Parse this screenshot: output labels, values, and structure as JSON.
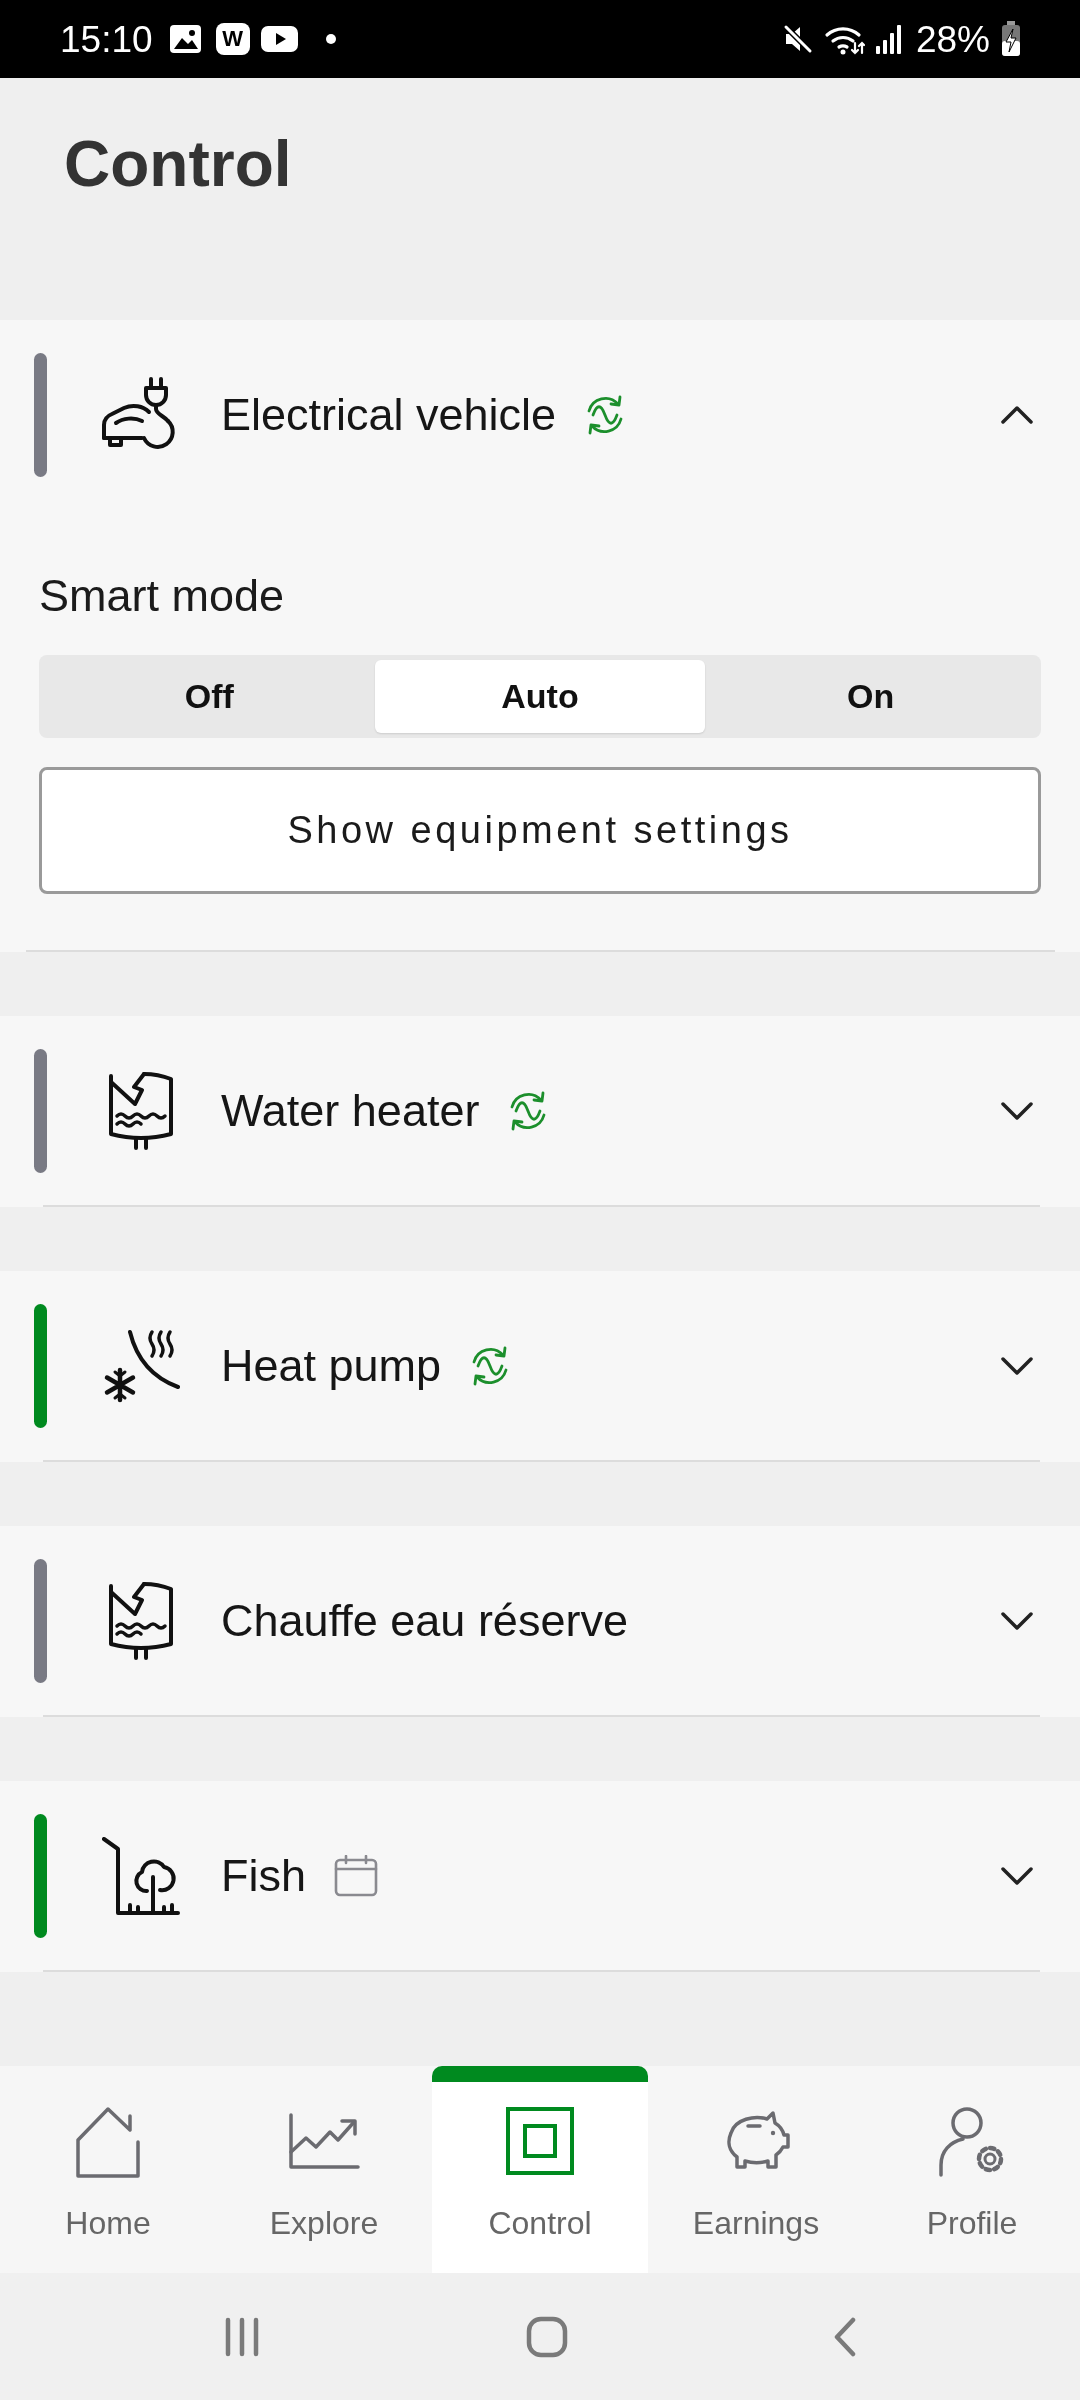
{
  "status_bar": {
    "time": "15:10",
    "app_letter": "W",
    "battery": "28%"
  },
  "header": {
    "title": "Control"
  },
  "devices": [
    {
      "name": "Electrical vehicle",
      "color": "#797a84",
      "synced": true,
      "scheduled": false,
      "expanded": true,
      "smart_mode": {
        "label": "Smart mode",
        "options": [
          {
            "label": "Off",
            "selected": false
          },
          {
            "label": "Auto",
            "selected": true
          },
          {
            "label": "On",
            "selected": false
          }
        ]
      },
      "settings_button": "Show equipment settings"
    },
    {
      "name": "Water heater",
      "color": "#797a84",
      "synced": true,
      "scheduled": false,
      "expanded": false
    },
    {
      "name": "Heat pump",
      "color": "#008a1f",
      "synced": true,
      "scheduled": false,
      "expanded": false
    },
    {
      "name": "Chauffe eau réserve",
      "color": "#797a84",
      "synced": false,
      "scheduled": false,
      "expanded": false
    },
    {
      "name": "Fish",
      "color": "#008a1f",
      "synced": false,
      "scheduled": true,
      "expanded": false
    }
  ],
  "nav": {
    "tabs": [
      {
        "label": "Home",
        "selected": false
      },
      {
        "label": "Explore",
        "selected": false
      },
      {
        "label": "Control",
        "selected": true
      },
      {
        "label": "Earnings",
        "selected": false
      },
      {
        "label": "Profile",
        "selected": false
      }
    ]
  }
}
